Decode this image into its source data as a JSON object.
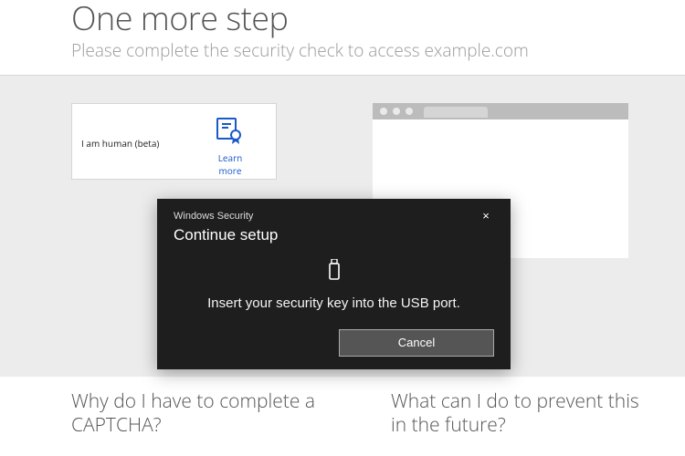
{
  "header": {
    "title": "One more step",
    "subtitle": "Please complete the security check to access example.com"
  },
  "captcha": {
    "label": "I am human (beta)",
    "learn_more": "Learn more",
    "icon_name": "certificate-icon"
  },
  "dialog": {
    "window_title": "Windows Security",
    "heading": "Continue setup",
    "message": "Insert your security key into the USB port.",
    "cancel_label": "Cancel",
    "close_glyph": "×",
    "icon_name": "usb-key-icon"
  },
  "faq": {
    "left": "Why do I have to complete a CAPTCHA?",
    "right": "What can I do to prevent this in the future?"
  }
}
